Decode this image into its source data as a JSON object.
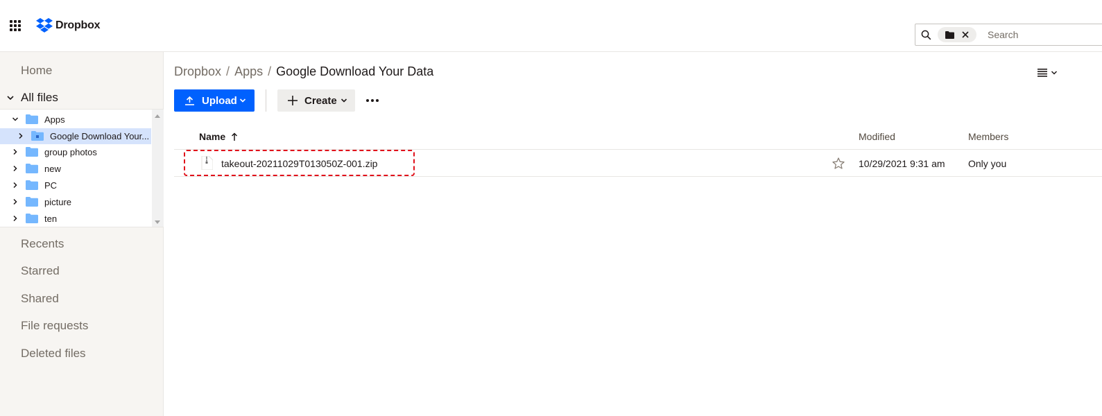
{
  "header": {
    "logo_text": "Dropbox",
    "search": {
      "placeholder": "Search",
      "chip": "folder-filter"
    }
  },
  "sidebar": {
    "home": "Home",
    "all_files": "All files",
    "tree": [
      {
        "label": "Apps",
        "expanded": true,
        "depth": 0
      },
      {
        "label": "Google Download Your...",
        "expanded": false,
        "depth": 1,
        "selected": true
      },
      {
        "label": "group photos",
        "expanded": false,
        "depth": 0
      },
      {
        "label": "new",
        "expanded": false,
        "depth": 0
      },
      {
        "label": "PC",
        "expanded": false,
        "depth": 0
      },
      {
        "label": "picture",
        "expanded": false,
        "depth": 0
      },
      {
        "label": "ten",
        "expanded": false,
        "depth": 0
      }
    ],
    "recents": "Recents",
    "starred": "Starred",
    "shared": "Shared",
    "file_requests": "File requests",
    "deleted_files": "Deleted files"
  },
  "breadcrumb": {
    "root": "Dropbox",
    "separator": "/",
    "middle": "Apps",
    "current": "Google Download Your Data"
  },
  "toolbar": {
    "upload_label": "Upload",
    "create_label": "Create"
  },
  "table": {
    "columns": {
      "name": "Name",
      "modified": "Modified",
      "members": "Members"
    },
    "rows": [
      {
        "name": "takeout-20211029T013050Z-001.zip",
        "modified": "10/29/2021 9:31 am",
        "members": "Only you",
        "starred": false
      }
    ]
  },
  "colors": {
    "accent": "#0061fe",
    "highlight": "#e0101a",
    "folder": "#75b7fe",
    "sidebar_bg": "#f7f5f2"
  }
}
